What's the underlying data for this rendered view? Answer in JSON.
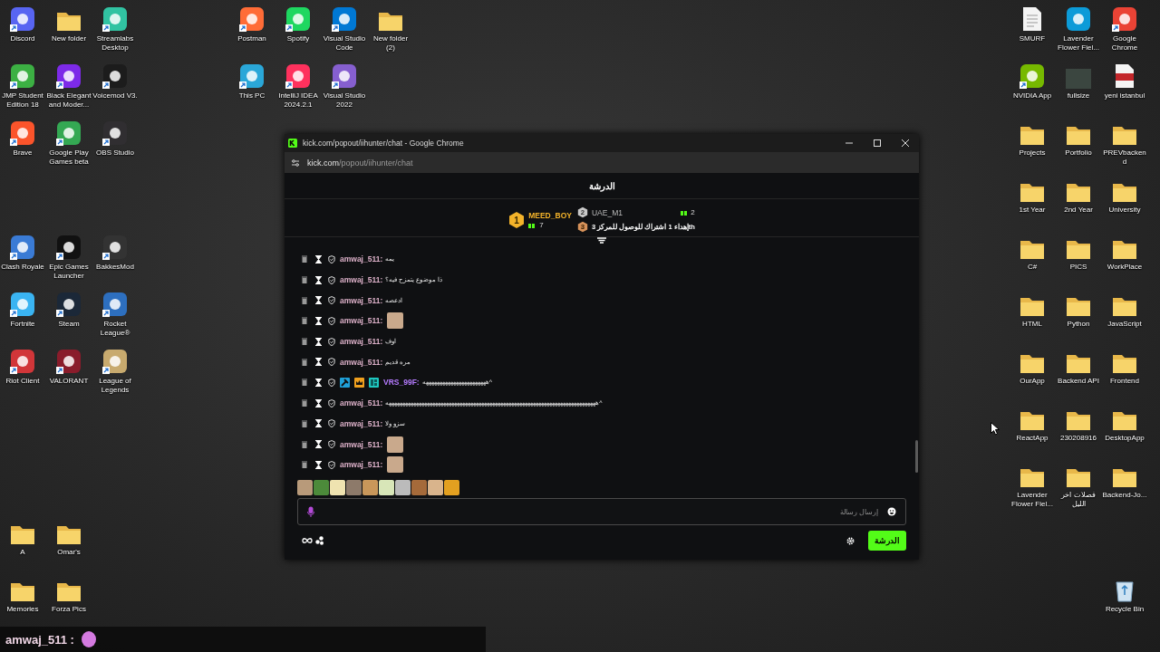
{
  "desktop": {
    "groups": [
      {
        "kind": "top_left",
        "icons": [
          {
            "label": "Discord",
            "kind": "app",
            "color": "#5865f2",
            "shortcut": true
          },
          {
            "label": "New folder",
            "kind": "folder",
            "shortcut": false
          },
          {
            "label": "Streamlabs Desktop",
            "kind": "app",
            "color": "#31c3a2",
            "shortcut": true
          },
          {
            "label": "JMP Student Edition 18",
            "kind": "app",
            "color": "#3cb043",
            "shortcut": true
          },
          {
            "label": "Black Elegant and Moder...",
            "kind": "app",
            "color": "#7d2ae8",
            "shortcut": true
          },
          {
            "label": "Voicemod V3.",
            "kind": "app",
            "color": "#1c1c1c",
            "shortcut": true
          },
          {
            "label": "Brave",
            "kind": "app",
            "color": "#fb542b",
            "shortcut": true
          },
          {
            "label": "Google Play Games beta",
            "kind": "app",
            "color": "#34a853",
            "shortcut": true
          },
          {
            "label": "OBS Studio",
            "kind": "app",
            "color": "#302e31",
            "shortcut": true
          }
        ]
      },
      {
        "kind": "games",
        "icons": [
          {
            "label": "Clash Royale",
            "kind": "app",
            "color": "#3a7bd5",
            "shortcut": true
          },
          {
            "label": "Epic Games Launcher",
            "kind": "app",
            "color": "#111111",
            "shortcut": true
          },
          {
            "label": "BakkesMod",
            "kind": "app",
            "color": "#333333",
            "shortcut": true
          },
          {
            "label": "Fortnite",
            "kind": "app",
            "color": "#3ab4f2",
            "shortcut": true
          },
          {
            "label": "Steam",
            "kind": "app",
            "color": "#1b2838",
            "shortcut": true
          },
          {
            "label": "Rocket League®",
            "kind": "app",
            "color": "#2d6fbf",
            "shortcut": true
          },
          {
            "label": "Riot Client",
            "kind": "app",
            "color": "#d13639",
            "shortcut": true
          },
          {
            "label": "VALORANT",
            "kind": "app",
            "color": "#8a1c2b",
            "shortcut": true
          },
          {
            "label": "League of Legends",
            "kind": "app",
            "color": "#c8aa6e",
            "shortcut": true
          }
        ]
      },
      {
        "kind": "bottom_left",
        "icons": [
          {
            "label": "A",
            "kind": "folder",
            "shortcut": false
          },
          {
            "label": "Omar's",
            "kind": "folder",
            "shortcut": false
          },
          {
            "label": "Memories",
            "kind": "folder",
            "shortcut": false
          },
          {
            "label": "Forza Pics",
            "kind": "folder",
            "shortcut": false
          }
        ]
      },
      {
        "kind": "top_middle",
        "icons": [
          {
            "label": "Postman",
            "kind": "app",
            "color": "#ff6c37",
            "shortcut": true
          },
          {
            "label": "Spotify",
            "kind": "app",
            "color": "#1ed760",
            "shortcut": true
          },
          {
            "label": "Visual Studio Code",
            "kind": "app",
            "color": "#0078d4",
            "shortcut": true
          },
          {
            "label": "New folder (2)",
            "kind": "folder",
            "shortcut": false
          },
          {
            "label": "This PC",
            "kind": "app",
            "color": "#2aa7d8",
            "shortcut": true
          },
          {
            "label": "IntelliJ IDEA 2024.2.1",
            "kind": "app",
            "color": "#fe315d",
            "shortcut": true
          },
          {
            "label": "Visual Studio 2022",
            "kind": "app",
            "color": "#865fcf",
            "shortcut": true
          }
        ]
      },
      {
        "kind": "right",
        "icons": [
          {
            "label": "SMURF",
            "kind": "file",
            "shortcut": false
          },
          {
            "label": "Lavender Flower Fiel...",
            "kind": "app",
            "color": "#0c9bd8",
            "shortcut": false
          },
          {
            "label": "Google Chrome",
            "kind": "app",
            "color": "#ea4335",
            "shortcut": true
          },
          {
            "label": "NVIDIA App",
            "kind": "app",
            "color": "#76b900",
            "shortcut": true
          },
          {
            "label": "fullsize",
            "kind": "image",
            "shortcut": false
          },
          {
            "label": "yeni istanbul",
            "kind": "pdf",
            "shortcut": false
          },
          {
            "label": "Projects",
            "kind": "folder",
            "shortcut": false
          },
          {
            "label": "Portfolio",
            "kind": "folder",
            "shortcut": false
          },
          {
            "label": "PREVbackend",
            "kind": "folder",
            "shortcut": false
          },
          {
            "label": "1st Year",
            "kind": "folder",
            "shortcut": false
          },
          {
            "label": "2nd Year",
            "kind": "folder",
            "shortcut": false
          },
          {
            "label": "University",
            "kind": "folder",
            "shortcut": false
          },
          {
            "label": "C#",
            "kind": "folder",
            "shortcut": false
          },
          {
            "label": "PICS",
            "kind": "folder",
            "shortcut": false
          },
          {
            "label": "WorkPlace",
            "kind": "folder",
            "shortcut": false
          },
          {
            "label": "HTML",
            "kind": "folder",
            "shortcut": false
          },
          {
            "label": "Python",
            "kind": "folder",
            "shortcut": false
          },
          {
            "label": "JavaScript",
            "kind": "folder",
            "shortcut": false
          },
          {
            "label": "OurApp",
            "kind": "folder",
            "shortcut": false
          },
          {
            "label": "Backend API",
            "kind": "folder",
            "shortcut": false
          },
          {
            "label": "Frontend",
            "kind": "folder",
            "shortcut": false
          },
          {
            "label": "ReactApp",
            "kind": "folder",
            "shortcut": false
          },
          {
            "label": "230208916",
            "kind": "folder",
            "shortcut": false
          },
          {
            "label": "DesktopApp",
            "kind": "folder",
            "shortcut": false
          },
          {
            "label": "Lavender Flower Fiel...",
            "kind": "folder",
            "shortcut": false
          },
          {
            "label": "فصلات اخر الليل",
            "kind": "folder",
            "shortcut": false
          },
          {
            "label": "Backend-Jo...",
            "kind": "folder",
            "shortcut": false
          }
        ]
      },
      {
        "kind": "bottom_right",
        "icons": [
          {
            "label": "Recycle Bin",
            "kind": "bin",
            "shortcut": false
          }
        ]
      }
    ]
  },
  "browser": {
    "title": "kick.com/popout/iihunter/chat - Google Chrome",
    "url_host": "kick.com",
    "url_path": "/popout/iihunter/chat"
  },
  "chat": {
    "title": "الدرشة",
    "leaderboard": {
      "first": {
        "rank": "1",
        "name": "MEED_BOY",
        "gifts": "7"
      },
      "second": {
        "rank": "2",
        "name": "UAE_M1",
        "gifts": "2"
      },
      "third": {
        "rank": "3",
        "text": "إهداء 1 اشتراك للوصول للمركز 3th"
      }
    },
    "messages": [
      {
        "user": "amwaj_511:",
        "color": "#dcb0c8",
        "kind": "text",
        "text": "يمه"
      },
      {
        "user": "amwaj_511:",
        "color": "#dcb0c8",
        "kind": "text",
        "text": "ذا موضوع يتمزح فيه؟"
      },
      {
        "user": "amwaj_511:",
        "color": "#dcb0c8",
        "kind": "text",
        "text": "ادعصه"
      },
      {
        "user": "amwaj_511:",
        "color": "#dcb0c8",
        "kind": "emote"
      },
      {
        "user": "amwaj_511:",
        "color": "#dcb0c8",
        "kind": "text",
        "text": "اوف"
      },
      {
        "user": "amwaj_511:",
        "color": "#dcb0c8",
        "kind": "text",
        "text": "مره قديم"
      },
      {
        "user": "VRS_99F:",
        "color": "#b57bff",
        "kind": "text",
        "text": "هههههههههههههههههههههههه^",
        "badges": [
          {
            "kind": "moderator"
          },
          {
            "kind": "vip"
          },
          {
            "kind": "og"
          }
        ]
      },
      {
        "user": "amwaj_511:",
        "color": "#dcb0c8",
        "kind": "text",
        "text": "هههههههههههههههههههههههههههههههههههههههههههههههههههههههههههههههههههههههههههههه^"
      },
      {
        "user": "amwaj_511:",
        "color": "#dcb0c8",
        "kind": "text",
        "text": "سزو ولا"
      },
      {
        "user": "amwaj_511:",
        "color": "#dcb0c8",
        "kind": "emote"
      },
      {
        "user": "amwaj_511:",
        "color": "#dcb0c8",
        "kind": "emote"
      }
    ],
    "input": {
      "placeholder": "إرسال رسالة"
    },
    "send_button": "الدرشة"
  },
  "overlay": {
    "user": "amwaj_511 :"
  }
}
